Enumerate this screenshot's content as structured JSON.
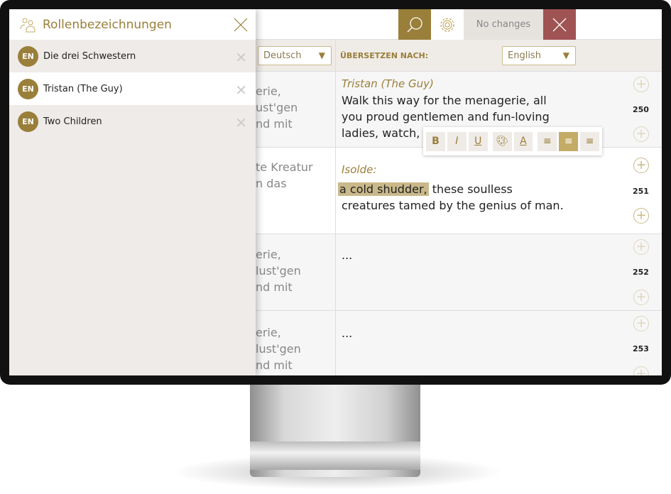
{
  "header": {
    "status": "No changes",
    "search_icon": "search-icon",
    "settings_icon": "gear-icon",
    "close_icon": "close-icon"
  },
  "colors": {
    "accent": "#9a7f3a",
    "close": "#a05353",
    "highlight": "#c9b98a"
  },
  "toolbar": {
    "source_language": "Deutsch",
    "translate_to_label": "ÜBERSETZEN NACH:",
    "target_language": "English"
  },
  "sidebar": {
    "title": "Rollenbezeichnungen",
    "items": [
      {
        "badge": "EN",
        "label": "Die drei Schwestern"
      },
      {
        "badge": "EN",
        "label": "Tristan (The Guy)"
      },
      {
        "badge": "EN",
        "label": "Two Children"
      }
    ]
  },
  "rows": [
    {
      "number": "250",
      "source": "erie,\nust'gen\nnd mit",
      "speaker": "Tristan (The Guy)",
      "text": "Walk this way for the menagerie, all you proud gentlemen and fun-loving ladies, watch, w"
    },
    {
      "number": "251",
      "source": "te Kreatur\nn das",
      "speaker": "Isolde:",
      "highlight": "a cold shudder,",
      "text": " these soulless creatures tamed by the genius of man."
    },
    {
      "number": "252",
      "source": "erie,\nlust'gen\nnd mit",
      "text": "..."
    },
    {
      "number": "253",
      "source": "erie,\nlust'gen\nnd mit",
      "text": "..."
    }
  ],
  "format_toolbar": {
    "bold": "B",
    "italic": "I",
    "underline": "U",
    "text_color": "A",
    "active_alignment": "center"
  }
}
